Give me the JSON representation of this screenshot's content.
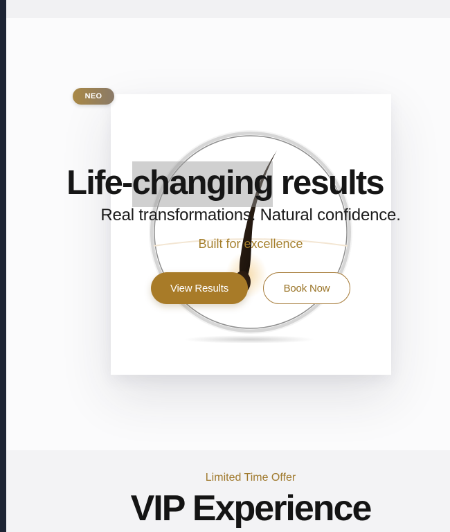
{
  "badge": {
    "label": "NEO"
  },
  "hero": {
    "headline_pre": "Life-",
    "headline_highlight": "changing",
    "headline_post": " results",
    "subheadline": "Real transformations. Natural confidence.",
    "tagline": "Built for excellence",
    "primary_button": "View Results",
    "secondary_button": "Book Now"
  },
  "offer": {
    "kicker": "Limited Time Offer",
    "title": "VIP Experience"
  },
  "colors": {
    "accent_gold": "#a87b28",
    "text_dark": "#161616",
    "rail": "#1d2434"
  },
  "icons": [
    "hair-follicle-illustration"
  ]
}
